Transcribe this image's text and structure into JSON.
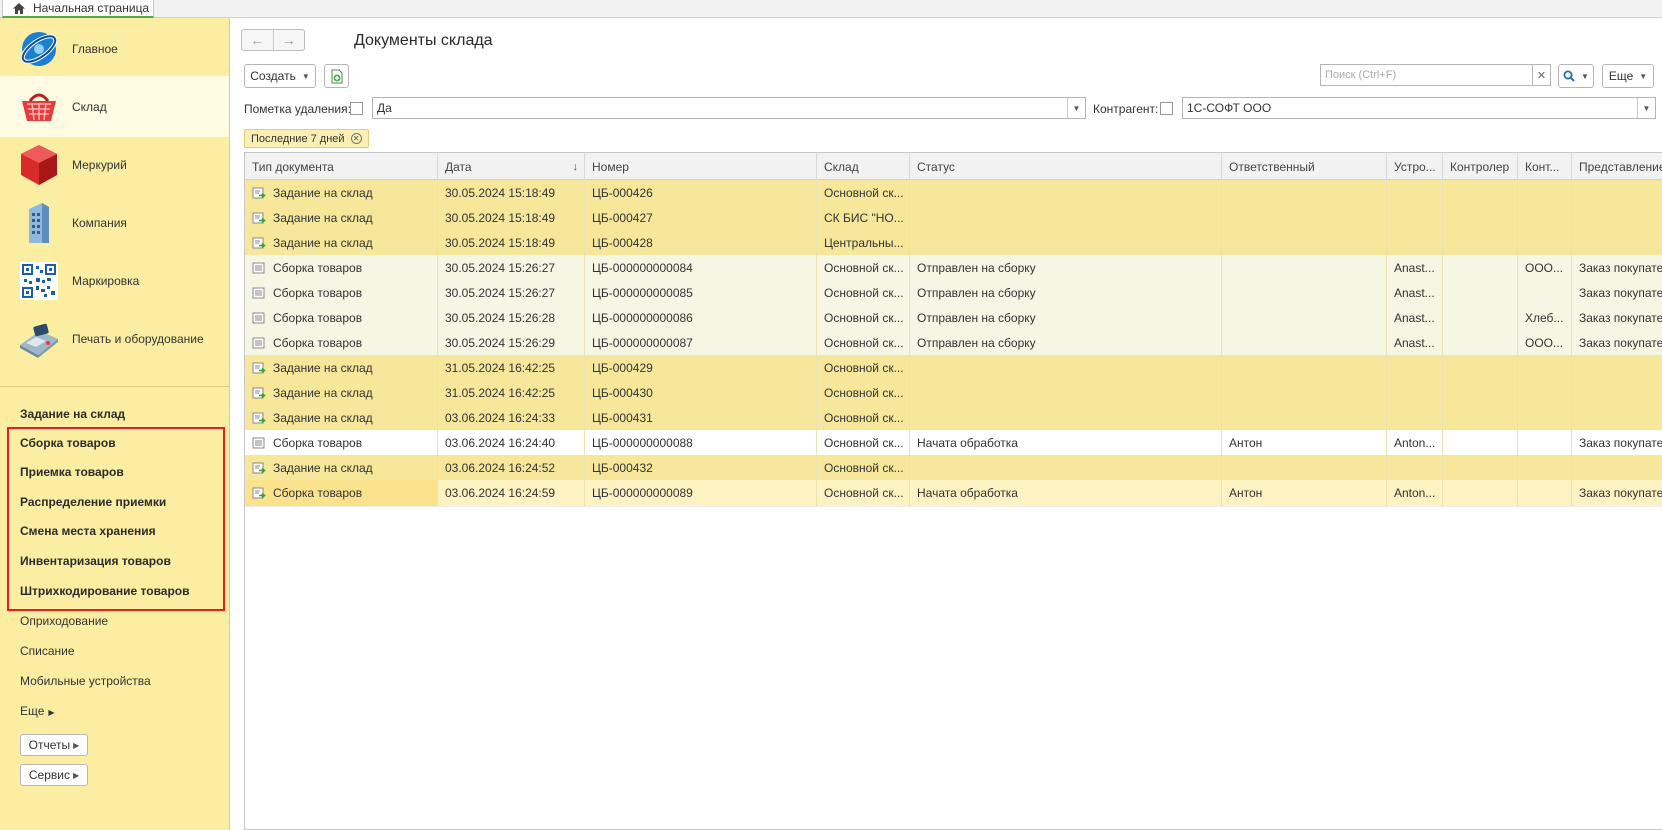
{
  "top_tab": {
    "label": "Начальная страница"
  },
  "sidebar": {
    "sections": [
      {
        "label": "Главное",
        "icon": "globe-logo-icon"
      },
      {
        "label": "Склад",
        "icon": "basket-icon"
      },
      {
        "label": "Меркурий",
        "icon": "red-cube-icon"
      },
      {
        "label": "Компания",
        "icon": "building-icon"
      },
      {
        "label": "Маркировка",
        "icon": "qr-code-icon"
      },
      {
        "label": "Печать и оборудование",
        "icon": "pos-terminal-icon"
      }
    ],
    "nav_items": [
      {
        "label": "Задание на склад",
        "bold": true
      },
      {
        "label": "Сборка товаров",
        "bold": true
      },
      {
        "label": "Приемка товаров",
        "bold": true
      },
      {
        "label": "Распределение приемки",
        "bold": true
      },
      {
        "label": "Смена места хранения",
        "bold": true
      },
      {
        "label": "Инвентаризация товаров",
        "bold": true
      },
      {
        "label": "Штрихкодирование товаров",
        "bold": true
      },
      {
        "label": "Оприходование",
        "bold": false
      },
      {
        "label": "Списание",
        "bold": false
      },
      {
        "label": "Мобильные устройства",
        "bold": false
      }
    ],
    "more_label": "Еще",
    "reports_label": "Отчеты",
    "service_label": "Сервис"
  },
  "main": {
    "title": "Документы склада",
    "create_label": "Создать",
    "search_placeholder": "Поиск (Ctrl+F)",
    "more_label": "Еще",
    "filters": {
      "deletion_label": "Пометка удаления:",
      "deletion_value": "Да",
      "contractor_label": "Контрагент:",
      "contractor_value": "1С-СОФТ ООО"
    },
    "period_chip": "Последние 7 дней"
  },
  "table": {
    "columns": [
      "Тип документа",
      "Дата",
      "Номер",
      "Склад",
      "Статус",
      "Ответственный",
      "Устро...",
      "Контролер",
      "Конт...",
      "Представление"
    ],
    "rows": [
      {
        "type": "Задание на склад",
        "date": "30.05.2024 15:18:49",
        "number": "ЦБ-000426",
        "warehouse": "Основной ск...",
        "status": "",
        "responsible": "",
        "device": "",
        "controller": "",
        "contr": "",
        "repr": "",
        "kind": "task"
      },
      {
        "type": "Задание на склад",
        "date": "30.05.2024 15:18:49",
        "number": "ЦБ-000427",
        "warehouse": "СК БИС \"НО...",
        "status": "",
        "responsible": "",
        "device": "",
        "controller": "",
        "contr": "",
        "repr": "",
        "kind": "task"
      },
      {
        "type": "Задание на склад",
        "date": "30.05.2024 15:18:49",
        "number": "ЦБ-000428",
        "warehouse": "Центральны...",
        "status": "",
        "responsible": "",
        "device": "",
        "controller": "",
        "contr": "",
        "repr": "",
        "kind": "task"
      },
      {
        "type": "Сборка товаров",
        "date": "30.05.2024 15:26:27",
        "number": "ЦБ-000000000084",
        "warehouse": "Основной ск...",
        "status": "Отправлен на сборку",
        "responsible": "",
        "device": "Anast...",
        "controller": "",
        "contr": "ООО...",
        "repr": "Заказ покупате",
        "kind": "pick"
      },
      {
        "type": "Сборка товаров",
        "date": "30.05.2024 15:26:27",
        "number": "ЦБ-000000000085",
        "warehouse": "Основной ск...",
        "status": "Отправлен на сборку",
        "responsible": "",
        "device": "Anast...",
        "controller": "",
        "contr": "",
        "repr": "Заказ покупате",
        "kind": "pick"
      },
      {
        "type": "Сборка товаров",
        "date": "30.05.2024 15:26:28",
        "number": "ЦБ-000000000086",
        "warehouse": "Основной ск...",
        "status": "Отправлен на сборку",
        "responsible": "",
        "device": "Anast...",
        "controller": "",
        "contr": "Хлеб...",
        "repr": "Заказ покупате",
        "kind": "pick"
      },
      {
        "type": "Сборка товаров",
        "date": "30.05.2024 15:26:29",
        "number": "ЦБ-000000000087",
        "warehouse": "Основной ск...",
        "status": "Отправлен на сборку",
        "responsible": "",
        "device": "Anast...",
        "controller": "",
        "contr": "ООО...",
        "repr": "Заказ покупате",
        "kind": "pick"
      },
      {
        "type": "Задание на склад",
        "date": "31.05.2024 16:42:25",
        "number": "ЦБ-000429",
        "warehouse": "Основной ск...",
        "status": "",
        "responsible": "",
        "device": "",
        "controller": "",
        "contr": "",
        "repr": "",
        "kind": "task"
      },
      {
        "type": "Задание на склад",
        "date": "31.05.2024 16:42:25",
        "number": "ЦБ-000430",
        "warehouse": "Основной ск...",
        "status": "",
        "responsible": "",
        "device": "",
        "controller": "",
        "contr": "",
        "repr": "",
        "kind": "task"
      },
      {
        "type": "Задание на склад",
        "date": "03.06.2024 16:24:33",
        "number": "ЦБ-000431",
        "warehouse": "Основной ск...",
        "status": "",
        "responsible": "",
        "device": "",
        "controller": "",
        "contr": "",
        "repr": "",
        "kind": "task"
      },
      {
        "type": "Сборка товаров",
        "date": "03.06.2024 16:24:40",
        "number": "ЦБ-000000000088",
        "warehouse": "Основной ск...",
        "status": "Начата обработка",
        "responsible": "Антон",
        "device": "Anton...",
        "controller": "",
        "contr": "",
        "repr": "Заказ покупате",
        "kind": "white"
      },
      {
        "type": "Задание на склад",
        "date": "03.06.2024 16:24:52",
        "number": "ЦБ-000432",
        "warehouse": "Основной ск...",
        "status": "",
        "responsible": "",
        "device": "",
        "controller": "",
        "contr": "",
        "repr": "",
        "kind": "task"
      },
      {
        "type": "Сборка товаров",
        "date": "03.06.2024 16:24:59",
        "number": "ЦБ-000000000089",
        "warehouse": "Основной ск...",
        "status": "Начата обработка",
        "responsible": "Антон",
        "device": "Anton...",
        "controller": "",
        "contr": "",
        "repr": "Заказ покупате",
        "kind": "current"
      }
    ]
  },
  "colors": {
    "sidebar_bg": "#fbeda1",
    "task_row": "#f6e79a",
    "pick_row": "#f6f6e4",
    "current_cell": "#fbe38e",
    "highlight_border": "#e81f1f",
    "home_tab_accent": "#5aa54a"
  }
}
